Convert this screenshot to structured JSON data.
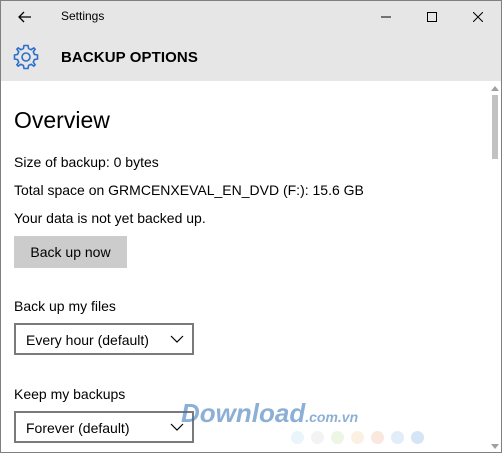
{
  "window": {
    "title": "Settings",
    "controls": {
      "minimize": "minimize",
      "maximize": "maximize",
      "close": "close"
    }
  },
  "header": {
    "title": "BACKUP OPTIONS",
    "icon": "gear-icon"
  },
  "overview": {
    "heading": "Overview",
    "size_of_backup": "Size of backup: 0 bytes",
    "total_space": "Total space on GRMCENXEVAL_EN_DVD (F:): 15.6 GB",
    "status": "Your data is not yet backed up.",
    "back_up_now_label": "Back up now"
  },
  "settings": {
    "backup_files_label": "Back up my files",
    "backup_files_value": "Every hour (default)",
    "keep_backups_label": "Keep my backups",
    "keep_backups_value": "Forever (default)"
  },
  "watermark": {
    "text": "Download",
    "suffix": ".com.vn",
    "dot_colors": [
      "#cfe8f6",
      "#e4e4e4",
      "#d6ecc6",
      "#f7e0c0",
      "#f5cbb8",
      "#bcd6f2",
      "#9fc7ec"
    ]
  },
  "colors": {
    "chrome": "#e6e6e6",
    "button": "#cccccc",
    "accent": "#2a6fcb"
  }
}
